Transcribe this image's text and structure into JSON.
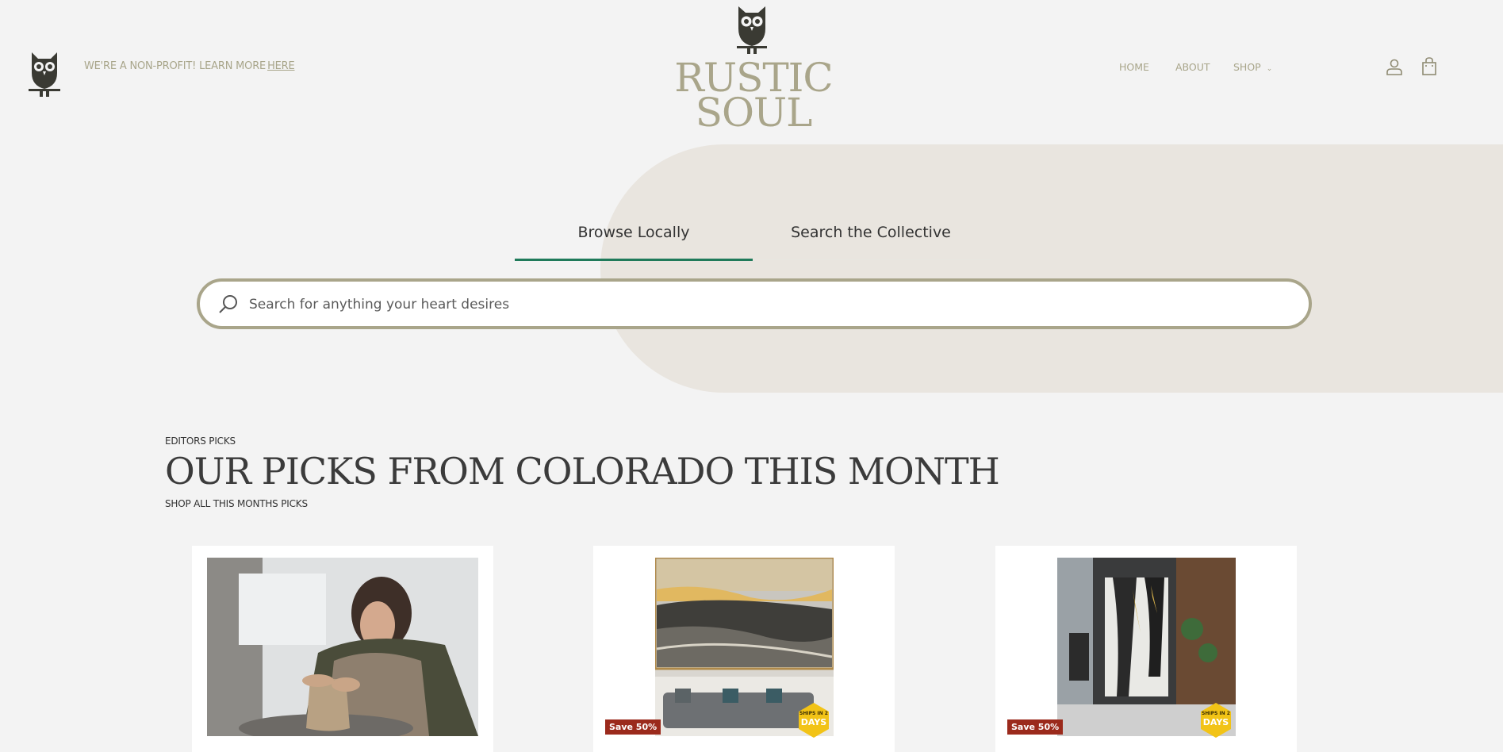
{
  "header": {
    "promo_text": "WE'RE A NON-PROFIT! LEARN MORE",
    "promo_link": "HERE",
    "logo_line1": "RUSTIC",
    "logo_line2": "SOUL",
    "nav": {
      "home": "HOME",
      "about": "ABOUT",
      "shop": "SHOP"
    }
  },
  "search": {
    "tabs": [
      "Browse Locally",
      "Search the Collective"
    ],
    "active_tab": "Browse Locally",
    "placeholder": "Search for anything your heart desires"
  },
  "picks": {
    "eyebrow": "EDITORS PICKS",
    "headline": "OUR PICKS FROM COLORADO THIS MONTH",
    "shop_all": "SHOP ALL THIS MONTHS PICKS",
    "cards": [
      {
        "image": "potter-at-wheel"
      },
      {
        "image": "ocean-painting-living-room",
        "badge": "Save 50%",
        "ships_badge": "SHIPS IN 2 DAYS"
      },
      {
        "image": "abstract-gold-painting-interior",
        "badge": "Save 50%",
        "ships_badge": "SHIPS IN 2 DAYS"
      }
    ]
  },
  "colors": {
    "accent": "#a9a58a",
    "active_tab": "#1f7a5a",
    "hero_shape": "#e9e5df",
    "badge": "#9b2a1c"
  }
}
